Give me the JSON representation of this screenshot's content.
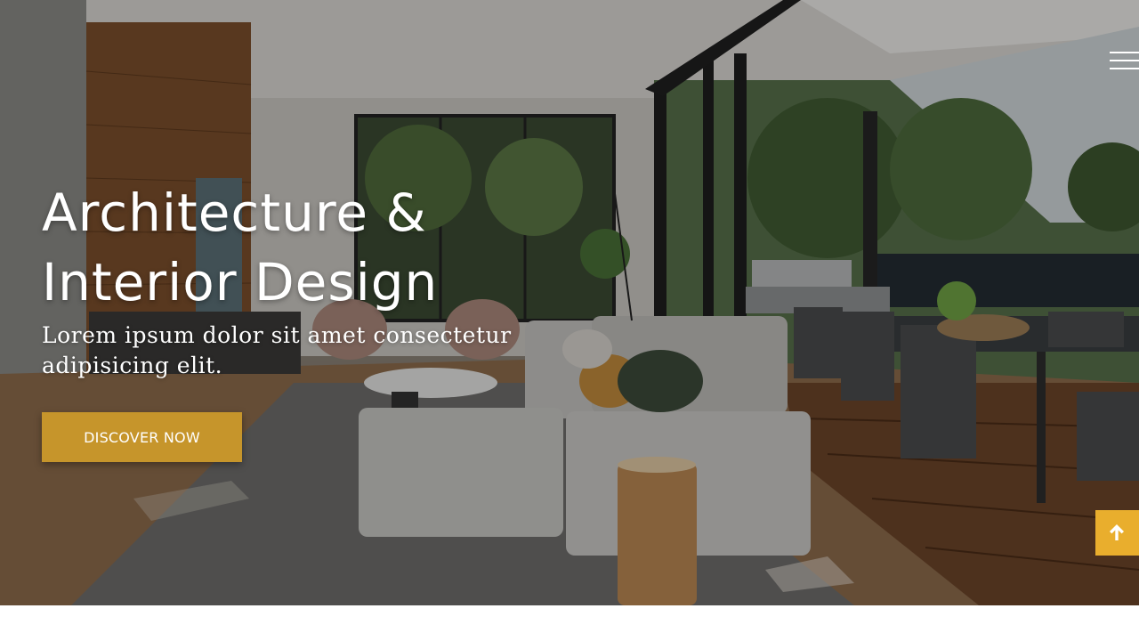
{
  "hero": {
    "title_line1": "Architecture &",
    "title_line2": "Interior Design",
    "subtitle": "Lorem ipsum dolor sit amet consectetur adipisicing elit.",
    "cta_label": "DISCOVER NOW",
    "background": "modern living room with sectional sofa, dining patio and glass sliding doors"
  },
  "nav": {
    "menu_icon": "hamburger-menu-icon"
  },
  "floating": {
    "back_to_top_icon": "arrow-up-icon"
  },
  "colors": {
    "accent": "#c6952b",
    "back_to_top": "#e9ae2d",
    "text": "#ffffff"
  }
}
